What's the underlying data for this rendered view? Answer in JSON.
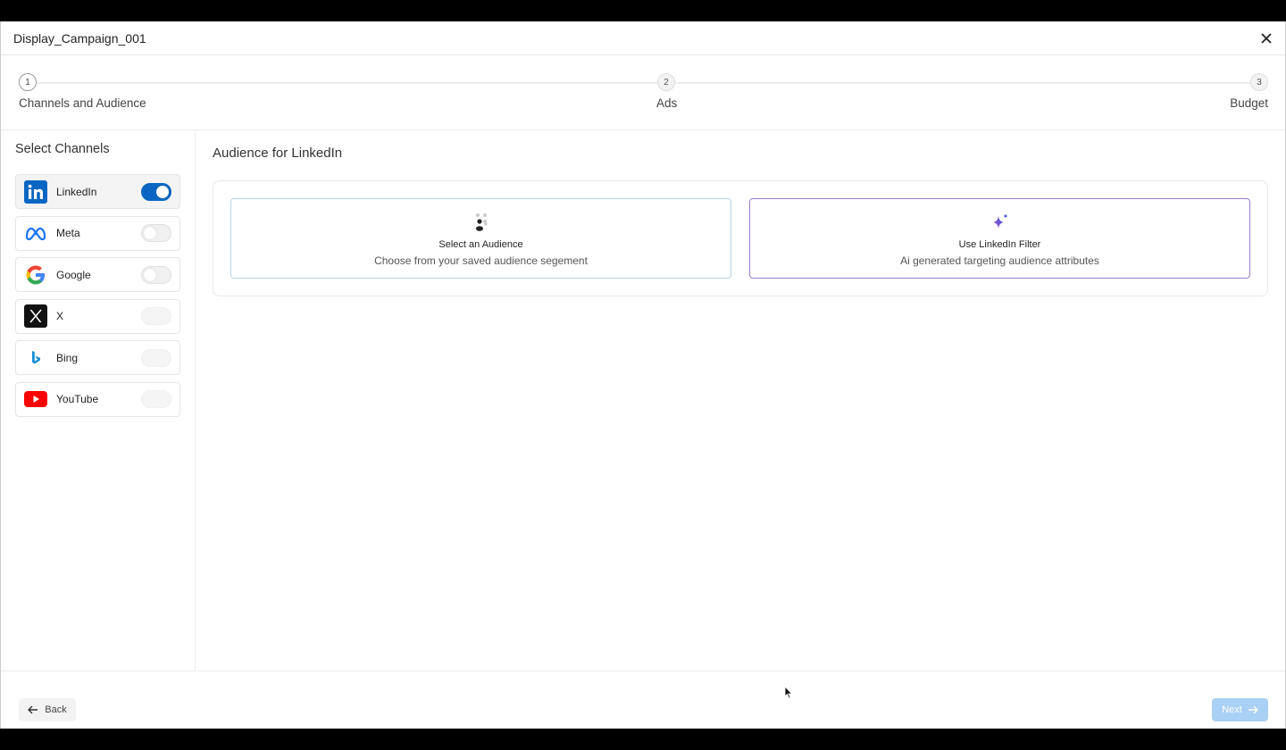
{
  "window": {
    "title": "Display_Campaign_001"
  },
  "stepper": {
    "steps": [
      {
        "number": "1",
        "label": "Channels and Audience"
      },
      {
        "number": "2",
        "label": "Ads"
      },
      {
        "number": "3",
        "label": "Budget"
      }
    ]
  },
  "sidebar": {
    "heading": "Select Channels",
    "channels": [
      {
        "name": "LinkedIn",
        "icon": "linkedin-icon",
        "enabled": true
      },
      {
        "name": "Meta",
        "icon": "meta-icon",
        "enabled": false
      },
      {
        "name": "Google",
        "icon": "google-icon",
        "enabled": false
      },
      {
        "name": "X",
        "icon": "x-icon",
        "enabled": false
      },
      {
        "name": "Bing",
        "icon": "bing-icon",
        "enabled": false
      },
      {
        "name": "YouTube",
        "icon": "youtube-icon",
        "enabled": false
      }
    ]
  },
  "main": {
    "heading": "Audience for LinkedIn",
    "options": [
      {
        "title": "Select an Audience",
        "subtitle": "Choose from your saved audience segement",
        "icon": "people-icon"
      },
      {
        "title": "Use LinkedIn Filter",
        "subtitle": "Ai generated targeting audience attributes",
        "icon": "sparkle-icon"
      }
    ]
  },
  "footer": {
    "back_label": "Back",
    "next_label": "Next"
  },
  "colors": {
    "accent": "#0a66c2",
    "next_button": "#a9d0f5",
    "ai_option_border": "#9a7cc8"
  }
}
